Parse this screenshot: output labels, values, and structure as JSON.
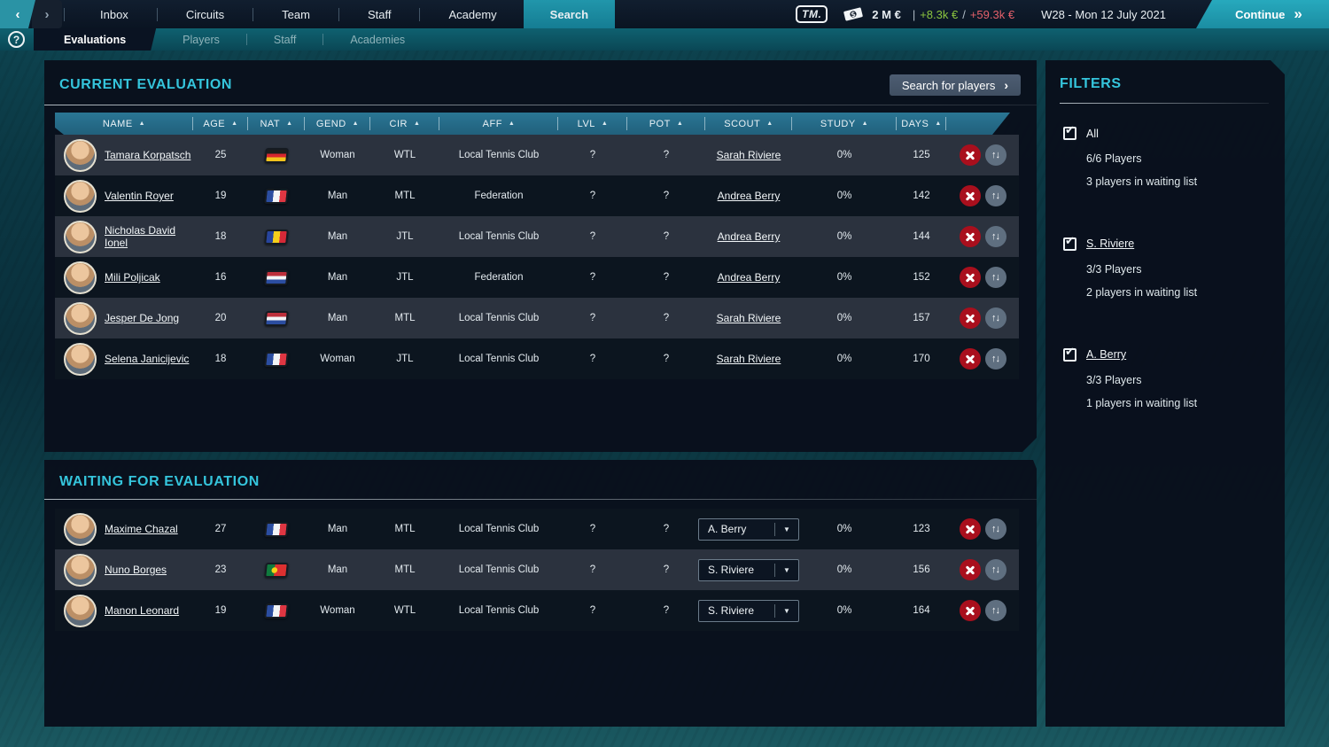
{
  "icons": {
    "back": "‹",
    "forward": "›",
    "double_chevron": "»",
    "single_chevron": "›",
    "sort_asc": "▲",
    "dropdown_arrow": "▼",
    "check": "✔",
    "swap_up": "↑",
    "swap_down": "↓",
    "help": "?"
  },
  "top_nav": {
    "logo": "TM.",
    "tabs": [
      {
        "label": "Inbox"
      },
      {
        "label": "Circuits"
      },
      {
        "label": "Team"
      },
      {
        "label": "Staff"
      },
      {
        "label": "Academy"
      },
      {
        "label": "Search"
      }
    ],
    "money": "2 M €",
    "money_pipe": "|",
    "money_gain": "+8.3k €",
    "money_slash": "/",
    "money_loss": "+59.3k €",
    "date": "W28 - Mon 12 July 2021",
    "continue_label": "Continue"
  },
  "sub_nav": {
    "tabs": [
      {
        "label": "Evaluations"
      },
      {
        "label": "Players"
      },
      {
        "label": "Staff"
      },
      {
        "label": "Academies"
      }
    ]
  },
  "current_evaluation": {
    "title": "CURRENT EVALUATION",
    "search_button": "Search for players",
    "columns": [
      "NAME",
      "AGE",
      "NAT",
      "GEND",
      "CIR",
      "AFF",
      "LVL",
      "POT",
      "SCOUT",
      "STUDY",
      "DAYS"
    ],
    "rows": [
      {
        "name": "Tamara Korpatsch",
        "age": "25",
        "nat": "de",
        "gend": "Woman",
        "cir": "WTL",
        "aff": "Local Tennis Club",
        "lvl": "?",
        "pot": "?",
        "scout": "Sarah Riviere",
        "study": "0%",
        "days": "125"
      },
      {
        "name": "Valentin Royer",
        "age": "19",
        "nat": "fr",
        "gend": "Man",
        "cir": "MTL",
        "aff": "Federation",
        "lvl": "?",
        "pot": "?",
        "scout": "Andrea Berry",
        "study": "0%",
        "days": "142"
      },
      {
        "name": "Nicholas David Ionel",
        "age": "18",
        "nat": "ro",
        "gend": "Man",
        "cir": "JTL",
        "aff": "Local Tennis Club",
        "lvl": "?",
        "pot": "?",
        "scout": "Andrea Berry",
        "study": "0%",
        "days": "144"
      },
      {
        "name": "Mili Poljicak",
        "age": "16",
        "nat": "hr",
        "gend": "Man",
        "cir": "JTL",
        "aff": "Federation",
        "lvl": "?",
        "pot": "?",
        "scout": "Andrea Berry",
        "study": "0%",
        "days": "152"
      },
      {
        "name": "Jesper De Jong",
        "age": "20",
        "nat": "nl",
        "gend": "Man",
        "cir": "MTL",
        "aff": "Local Tennis Club",
        "lvl": "?",
        "pot": "?",
        "scout": "Sarah Riviere",
        "study": "0%",
        "days": "157"
      },
      {
        "name": "Selena Janicijevic",
        "age": "18",
        "nat": "fr",
        "gend": "Woman",
        "cir": "JTL",
        "aff": "Local Tennis Club",
        "lvl": "?",
        "pot": "?",
        "scout": "Sarah Riviere",
        "study": "0%",
        "days": "170"
      }
    ]
  },
  "waiting_for_evaluation": {
    "title": "WAITING FOR EVALUATION",
    "rows": [
      {
        "name": "Maxime Chazal",
        "age": "27",
        "nat": "fr",
        "gend": "Man",
        "cir": "MTL",
        "aff": "Local Tennis Club",
        "lvl": "?",
        "pot": "?",
        "scout_selected": "A. Berry",
        "study": "0%",
        "days": "123"
      },
      {
        "name": "Nuno Borges",
        "age": "23",
        "nat": "pt",
        "gend": "Man",
        "cir": "MTL",
        "aff": "Local Tennis Club",
        "lvl": "?",
        "pot": "?",
        "scout_selected": "S. Riviere",
        "study": "0%",
        "days": "156"
      },
      {
        "name": "Manon Leonard",
        "age": "19",
        "nat": "fr",
        "gend": "Woman",
        "cir": "WTL",
        "aff": "Local Tennis Club",
        "lvl": "?",
        "pot": "?",
        "scout_selected": "S. Riviere",
        "study": "0%",
        "days": "164"
      }
    ]
  },
  "filters": {
    "title": "FILTERS",
    "items": [
      {
        "label": "All",
        "checked": true,
        "underline": false,
        "players": "6/6 Players",
        "waiting": "3 players in waiting list"
      },
      {
        "label": "S. Riviere",
        "checked": true,
        "underline": true,
        "players": "3/3 Players",
        "waiting": "2 players in waiting list"
      },
      {
        "label": "A. Berry",
        "checked": true,
        "underline": true,
        "players": "3/3 Players",
        "waiting": "1 players in waiting list"
      }
    ]
  }
}
